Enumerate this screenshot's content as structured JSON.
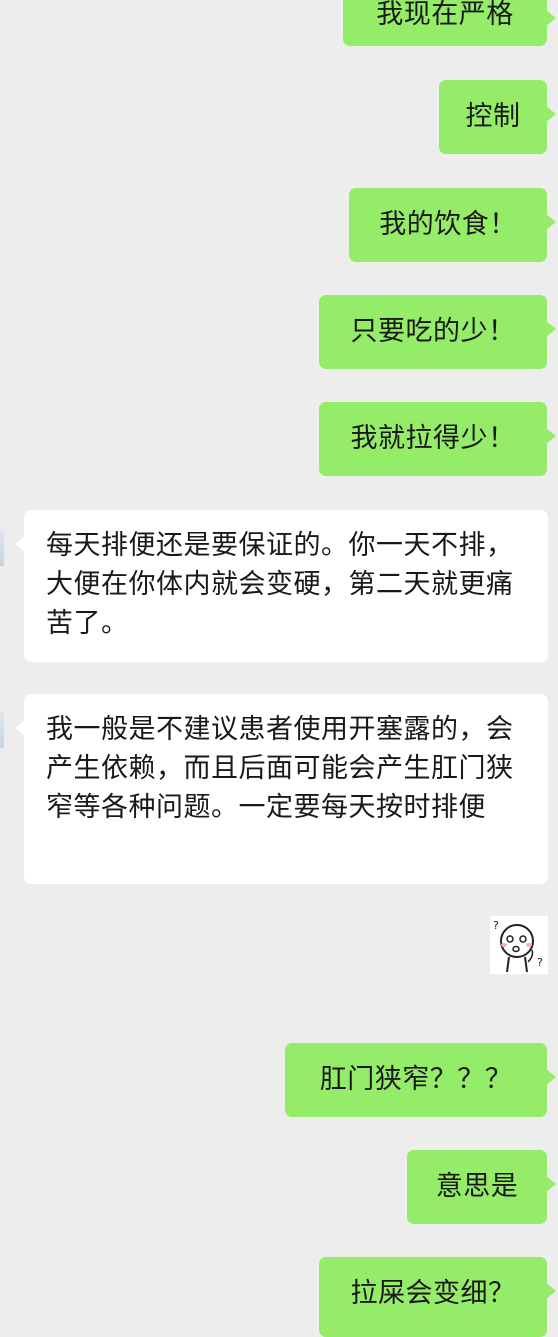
{
  "messages": [
    {
      "sender": "me",
      "text": "我现在严格"
    },
    {
      "sender": "me",
      "text": "控制"
    },
    {
      "sender": "me",
      "text": "我的饮食！"
    },
    {
      "sender": "me",
      "text": "只要吃的少！"
    },
    {
      "sender": "me",
      "text": "我就拉得少！"
    },
    {
      "sender": "them",
      "text": "每天排便还是要保证的。你一天不排，大便在你体内就会变硬，第二天就更痛苦了。"
    },
    {
      "sender": "them",
      "text": "我一般是不建议患者使用开塞露的，会产生依赖，而且后面可能会产生肛门狭窄等各种问题。一定要每天按时排便"
    },
    {
      "sender": "me",
      "sticker": "confused-face-sticker"
    },
    {
      "sender": "me",
      "text": "肛门狭窄？？？"
    },
    {
      "sender": "me",
      "text": "意思是"
    },
    {
      "sender": "me",
      "text": "拉屎会变细？"
    }
  ],
  "colors": {
    "background": "#ededed",
    "sent_bubble": "#95ec69",
    "received_bubble": "#ffffff",
    "text": "#191919"
  }
}
